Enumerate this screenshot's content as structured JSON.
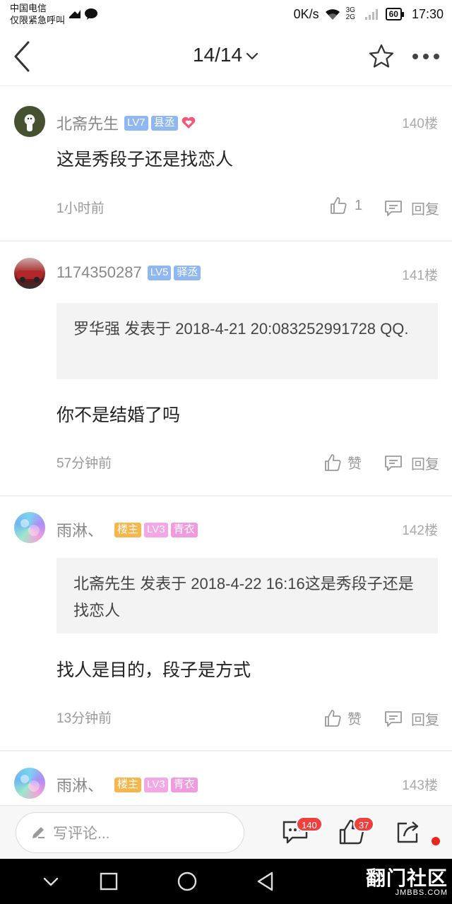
{
  "status_bar": {
    "carrier_line1": "中国电信",
    "carrier_line2": "仅限紧急呼叫",
    "net_speed": "0K/s",
    "network": "3G 2G",
    "battery": "60",
    "time": "17:30"
  },
  "nav": {
    "page_indicator": "14/14",
    "back_icon": "chevron-left-icon",
    "favorite_icon": "star-icon",
    "more_icon": "more-dots-icon"
  },
  "posts": [
    {
      "username": "北斋先生",
      "badges": [
        "LV7",
        "县丞"
      ],
      "has_heart": true,
      "floor": "140楼",
      "quote": null,
      "content": "这是秀段子还是找恋人",
      "time": "1小时前",
      "like_label": "1",
      "reply_label": "回复"
    },
    {
      "username": "1174350287",
      "badges": [
        "LV5",
        "驿丞"
      ],
      "has_heart": false,
      "floor": "141楼",
      "quote": "罗华强 发表于 2018-4-21 20:083252991728 QQ.",
      "content": "你不是结婚了吗",
      "time": "57分钟前",
      "like_label": "赞",
      "reply_label": "回复"
    },
    {
      "username": "雨淋、",
      "badges": [
        "楼主",
        "LV3",
        "青衣"
      ],
      "has_heart": false,
      "floor": "142楼",
      "quote": "北斋先生 发表于 2018-4-22 16:16这是秀段子还是找恋人",
      "content": "找人是目的，段子是方式",
      "time": "13分钟前",
      "like_label": "赞",
      "reply_label": "回复"
    },
    {
      "username": "雨淋、",
      "badges": [
        "楼主",
        "LV3",
        "青衣"
      ],
      "has_heart": false,
      "floor": "143楼"
    }
  ],
  "comment_bar": {
    "placeholder": "写评论...",
    "comment_count": "140",
    "like_count": "37"
  },
  "watermark": {
    "main": "翻门社区",
    "sub": "JMBBS.COM"
  },
  "colors": {
    "badge_blue": "#8fb8f2",
    "badge_owner": "#f6b64c",
    "badge_pink": "#f4a6e6",
    "count_red": "#f0403c"
  }
}
